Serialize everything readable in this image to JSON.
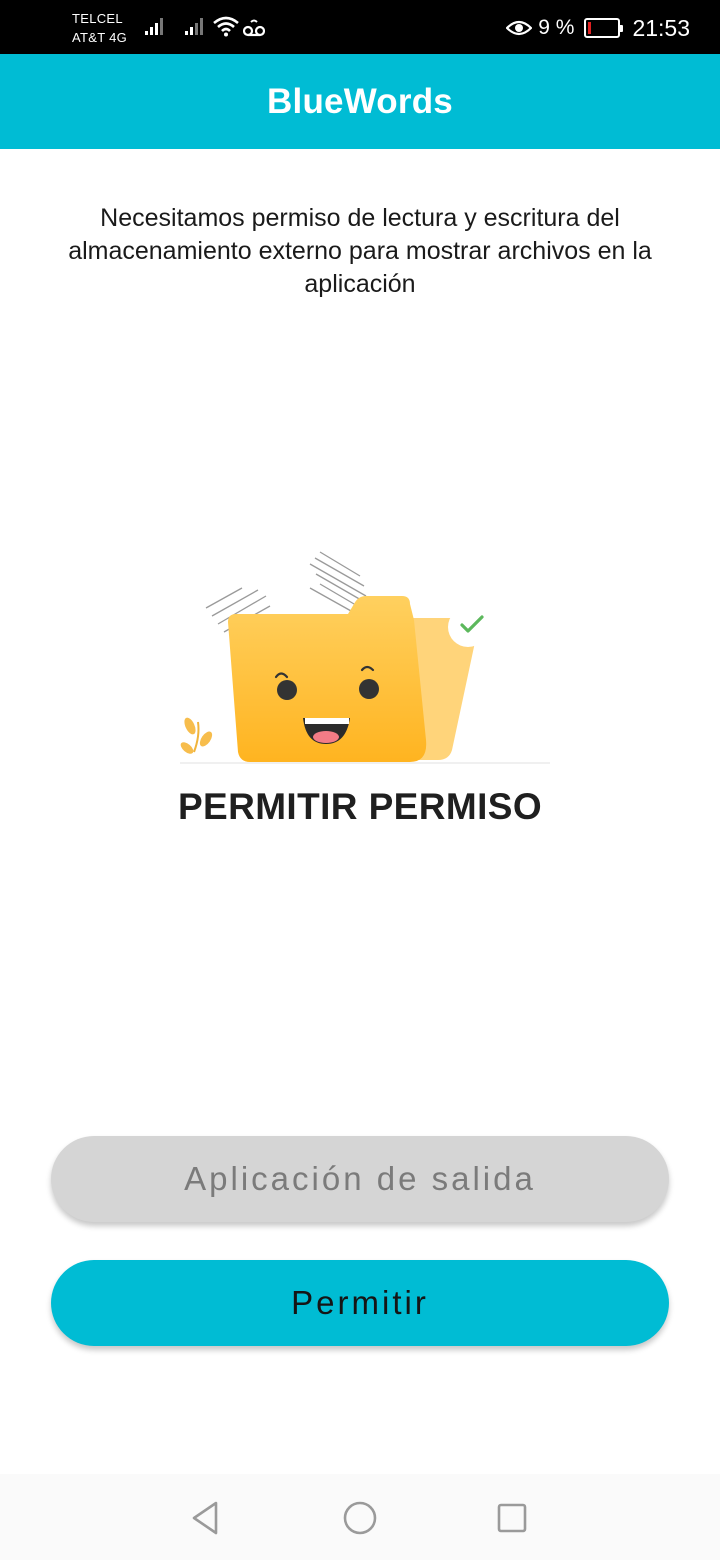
{
  "status_bar": {
    "carrier_1": "TELCEL",
    "carrier_2": "AT&T 4G",
    "battery_percent": "9 %",
    "battery_level": 0.09,
    "time": "21:53",
    "icons": [
      "signal-icon",
      "signal-icon",
      "wifi-icon",
      "voicemail-icon",
      "eye-comfort-icon",
      "battery-icon"
    ]
  },
  "app_bar": {
    "title": "BlueWords",
    "color": "#00bcd4"
  },
  "content": {
    "message": "Necesitamos permiso de lectura y escritura del almacenamiento externo para mostrar archivos en la aplicación",
    "illustration": "smiling-folder-illustration",
    "headline": "PERMITIR PERMISO"
  },
  "buttons": {
    "exit_label": "Aplicación de salida",
    "allow_label": "Permitir"
  },
  "nav_bar": {
    "icons": [
      "back-icon",
      "home-icon",
      "recents-icon"
    ]
  }
}
